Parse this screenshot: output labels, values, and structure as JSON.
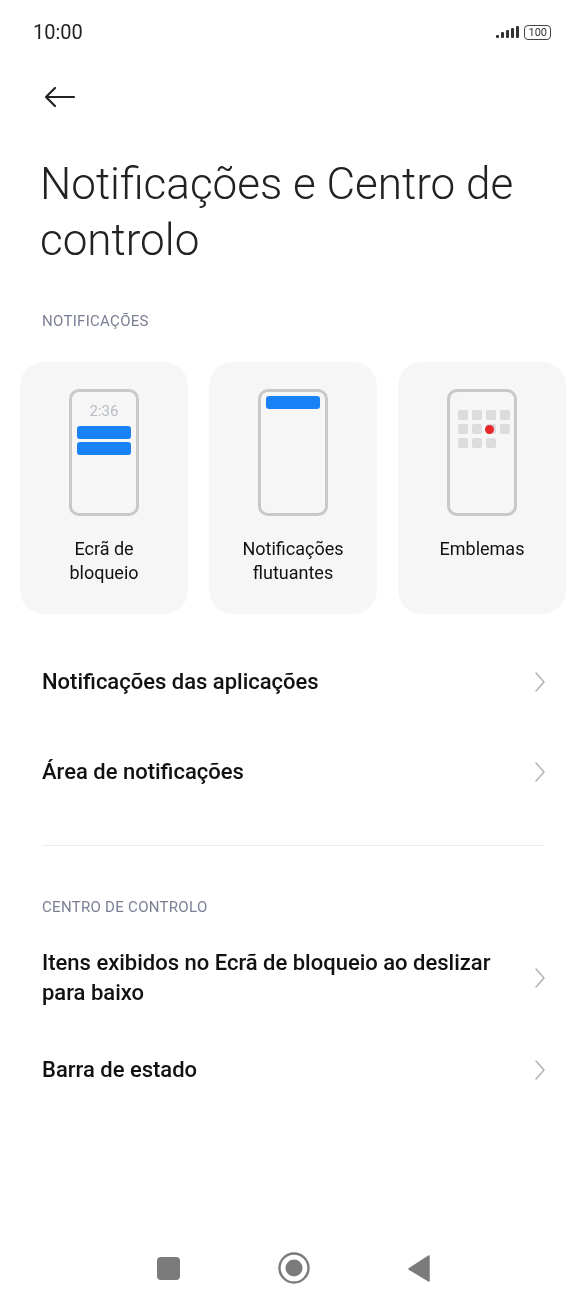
{
  "status_bar": {
    "time": "10:00",
    "battery": "100"
  },
  "title": "Notificações e Centro de controlo",
  "sections": [
    {
      "header": "NOTIFICAÇÕES",
      "cards": [
        {
          "kind": "lock",
          "clock": "2:36",
          "label": "Ecrã de bloqueio"
        },
        {
          "kind": "floating",
          "label": "Notificações flutuantes"
        },
        {
          "kind": "badges",
          "label": "Emblemas"
        }
      ],
      "items": [
        {
          "label": "Notificações das aplicações"
        },
        {
          "label": "Área de notificações"
        }
      ]
    },
    {
      "header": "CENTRO DE CONTROLO",
      "items": [
        {
          "label": "Itens exibidos no Ecrã de bloqueio ao deslizar para baixo"
        },
        {
          "label": "Barra de estado"
        }
      ]
    }
  ]
}
